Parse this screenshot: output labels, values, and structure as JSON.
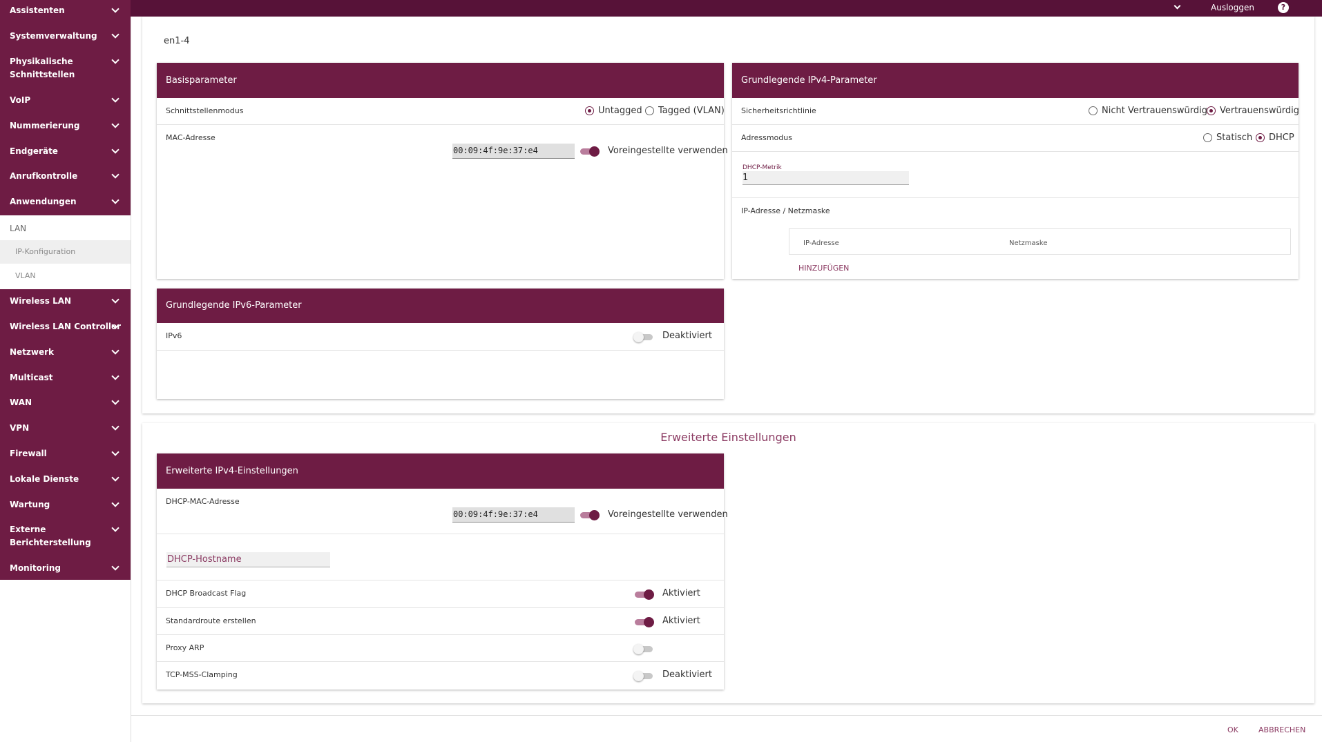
{
  "sidebar": {
    "items": [
      {
        "label": "Assistenten"
      },
      {
        "label": "Systemverwaltung"
      },
      {
        "label": "Physikalische\nSchnittstellen"
      },
      {
        "label": "VoIP"
      },
      {
        "label": "Nummerierung"
      },
      {
        "label": "Endgeräte"
      },
      {
        "label": "Anrufkontrolle"
      },
      {
        "label": "Anwendungen"
      },
      {
        "label": "Wireless LAN"
      },
      {
        "label": "Wireless LAN Controller"
      },
      {
        "label": "Netzwerk"
      },
      {
        "label": "Multicast"
      },
      {
        "label": "WAN"
      },
      {
        "label": "VPN"
      },
      {
        "label": "Firewall"
      },
      {
        "label": "Lokale Dienste"
      },
      {
        "label": "Wartung"
      },
      {
        "label": "Externe\nBerichterstellung"
      },
      {
        "label": "Monitoring"
      }
    ],
    "lan": {
      "label": "LAN",
      "sub": [
        {
          "label": "IP-Konfiguration",
          "active": true
        },
        {
          "label": "VLAN",
          "active": false
        }
      ]
    }
  },
  "topbar": {
    "logout": "Ausloggen",
    "help": "?"
  },
  "page": {
    "interface": "en1-4",
    "advanced_title": "Erweiterte Einstellungen"
  },
  "basis": {
    "title": "Basisparameter",
    "mode_label": "Schnittstellenmodus",
    "mode_options": [
      "Untagged",
      "Tagged (VLAN)"
    ],
    "mode_selected": "Untagged",
    "mac_label": "MAC-Adresse",
    "mac_value": "00:09:4f:9e:37:e4",
    "mac_toggle_label": "Voreingestellte verwenden",
    "mac_toggle_on": true
  },
  "ipv4": {
    "title": "Grundlegende IPv4-Parameter",
    "security_label": "Sicherheitsrichtlinie",
    "security_options": [
      "Nicht Vertrauenswürdig",
      "Vertrauenswürdig"
    ],
    "security_selected": "Vertrauenswürdig",
    "addr_mode_label": "Adressmodus",
    "addr_mode_options": [
      "Statisch",
      "DHCP"
    ],
    "addr_mode_selected": "DHCP",
    "metric_label": "DHCP-Metrik",
    "metric_value": "1",
    "ip_mask_label": "IP-Adresse / Netzmaske",
    "col_ip": "IP-Adresse",
    "col_mask": "Netzmaske",
    "add_button": "HINZUFÜGEN"
  },
  "ipv6": {
    "title": "Grundlegende IPv6-Parameter",
    "ipv6_label": "IPv6",
    "ipv6_state": "Deaktiviert",
    "ipv6_on": false
  },
  "adv": {
    "title": "Erweiterte IPv4-Einstellungen",
    "dhcp_mac_label": "DHCP-MAC-Adresse",
    "dhcp_mac_value": "00:09:4f:9e:37:e4",
    "dhcp_mac_toggle_label": "Voreingestellte verwenden",
    "hostname_placeholder": "DHCP-Hostname",
    "rows": [
      {
        "label": "DHCP Broadcast Flag",
        "state": "Aktiviert",
        "on": true
      },
      {
        "label": "Standardroute erstellen",
        "state": "Aktiviert",
        "on": true
      },
      {
        "label": "Proxy ARP",
        "state": "",
        "on": false
      },
      {
        "label": "TCP-MSS-Clamping",
        "state": "Deaktiviert",
        "on": false
      }
    ]
  },
  "footer": {
    "ok": "OK",
    "cancel": "ABBRECHEN"
  },
  "colors": {
    "primary": "#6e1c44",
    "topbar": "#571238",
    "accent_text": "#8b3a62"
  }
}
